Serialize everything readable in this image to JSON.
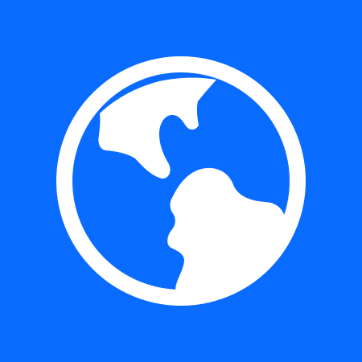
{
  "icon": {
    "name": "globe-icon",
    "background_color": "#0A6CFF",
    "foreground_color": "#FFFFFF"
  }
}
